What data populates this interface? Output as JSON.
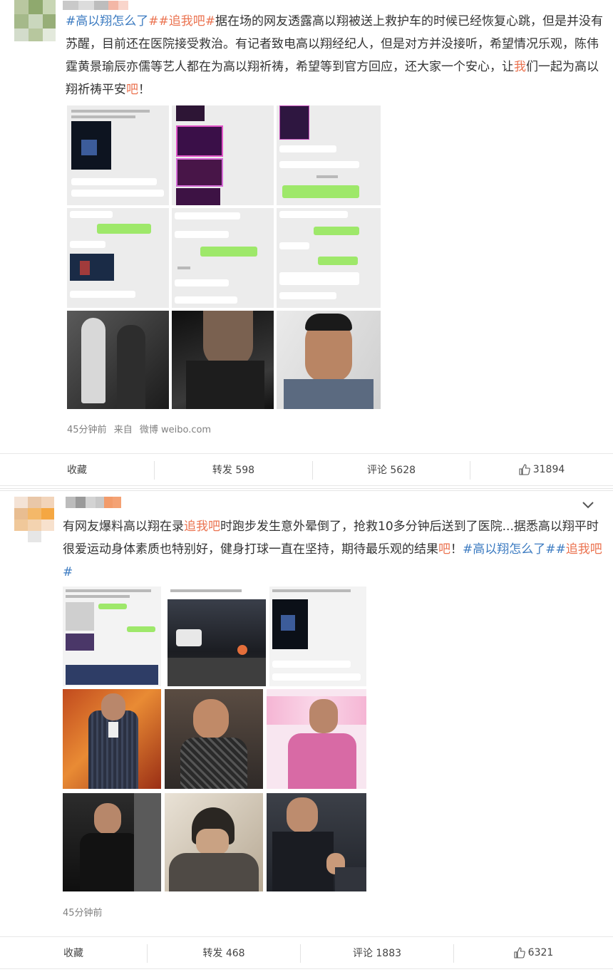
{
  "post1": {
    "tag_hash_open": "#",
    "topic1": "高以翔怎么了",
    "tag_hash_mid": "##",
    "tag1": "追我吧",
    "tag_hash_close": "#",
    "text_a": "据在场的网友透露高以翔被送上救护车的时候已经恢复心跳，但是并没有苏醒，目前还在医院接受救治。有记者致电高以翔经纪人，但是对方并没接听，希望情况乐观，陈伟霆黄景瑜辰亦儒等艺人都在为高以翔祈祷，希望等到官方回应，还大家一个安心，让",
    "hl_wo": "我",
    "text_b": "们一起为高以翔祈祷平安",
    "hl_ba": "吧",
    "text_c": "！",
    "time": "45分钟前",
    "source_prefix": "来自",
    "source": "微博 weibo.com",
    "actions": {
      "collect": "收藏",
      "repost": "转发 598",
      "comment": "评论 5628",
      "like": "31894"
    }
  },
  "post2": {
    "text_a": "有网友爆料高以翔在录",
    "tag1": "追我吧",
    "text_b": "时跑步发生意外晕倒了，抢救10多分钟后送到了医院...据悉高以翔平时很爱运动身体素质也特别好，健身打球一直在坚持，期待最乐观的结果",
    "hl_ba": "吧",
    "text_c": "！",
    "hash_open": "#",
    "topic1": "高以翔怎么了",
    "hash_mid": "##",
    "tag2": "追我吧",
    "hash_close": "#",
    "time": "45分钟前",
    "actions": {
      "collect": "收藏",
      "repost": "转发 468",
      "comment": "评论 1883",
      "like": "6321"
    }
  },
  "colors": {
    "accent_tag": "#eb7350",
    "accent_topic": "#3c7bc1",
    "meta": "#808080"
  }
}
